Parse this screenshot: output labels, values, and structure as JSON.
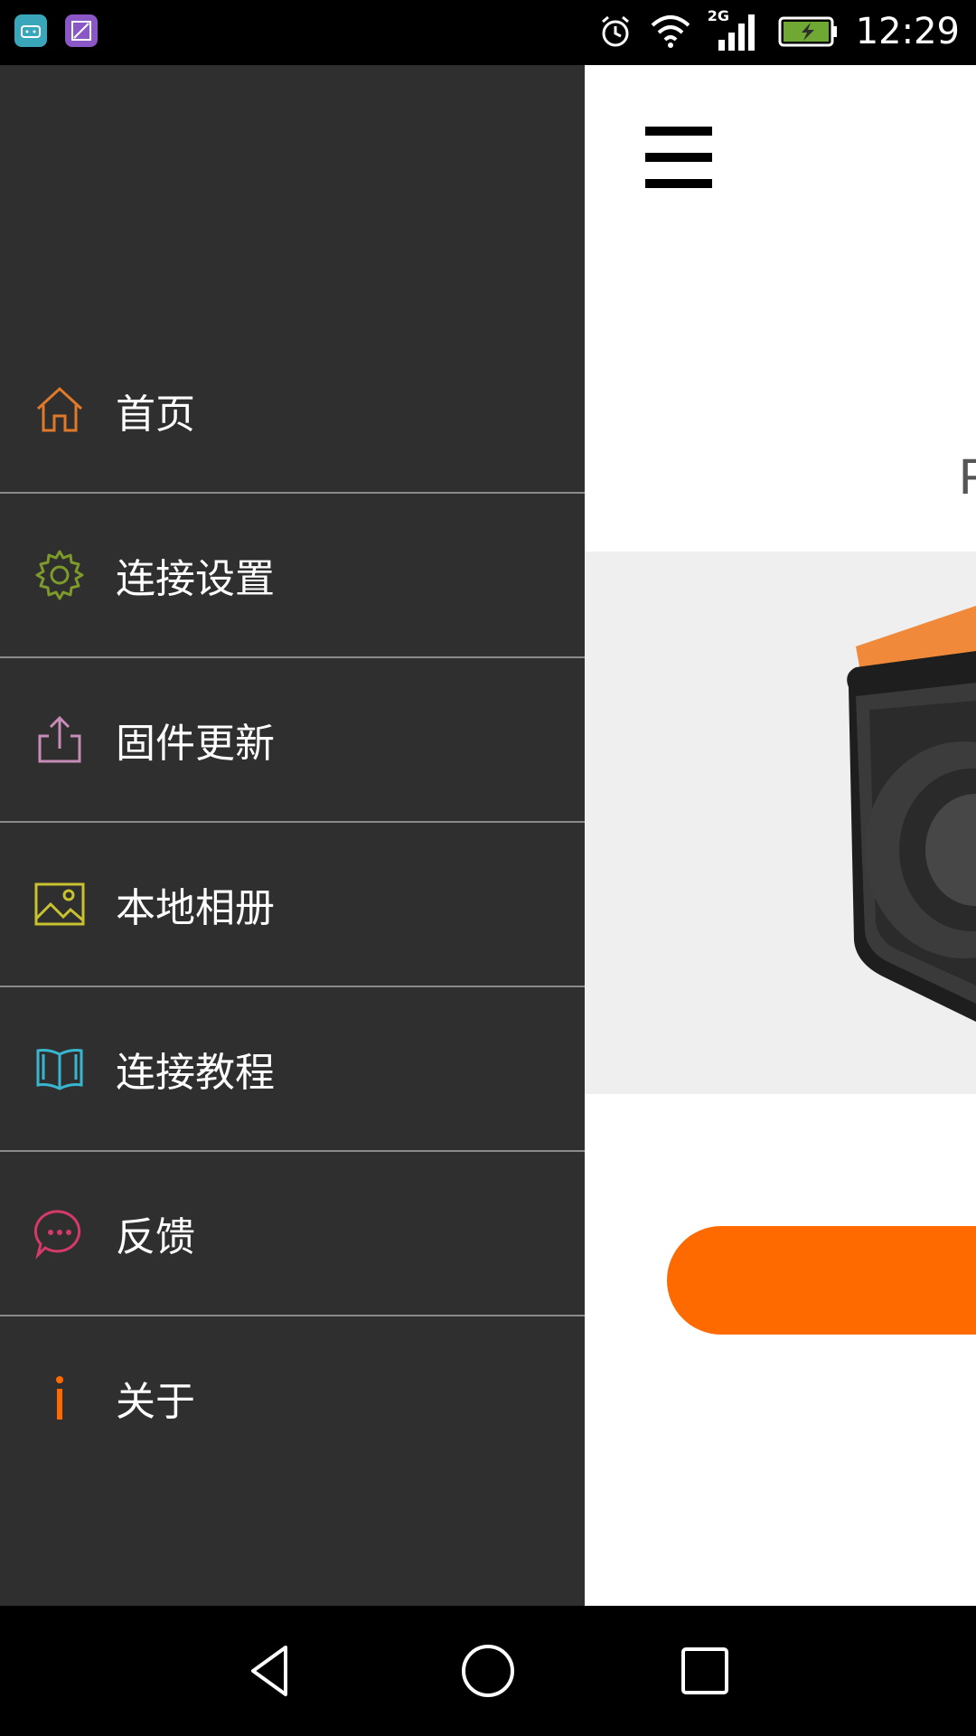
{
  "status_bar": {
    "time": "12:29",
    "network_type": "2G",
    "notification_icons": [
      "android-icon",
      "gallery-icon"
    ],
    "system_icons": [
      "alarm-icon",
      "wifi-icon",
      "signal-icon",
      "battery-charging-icon"
    ]
  },
  "drawer": {
    "items": [
      {
        "label": "首页",
        "icon": "home-icon",
        "icon_color": "#e07a2a"
      },
      {
        "label": "连接设置",
        "icon": "gear-icon",
        "icon_color": "#7d9a2a"
      },
      {
        "label": "固件更新",
        "icon": "upload-icon",
        "icon_color": "#c78bb8"
      },
      {
        "label": "本地相册",
        "icon": "image-icon",
        "icon_color": "#c9c22e"
      },
      {
        "label": "连接教程",
        "icon": "book-icon",
        "icon_color": "#39b6cf"
      },
      {
        "label": "反馈",
        "icon": "chat-icon",
        "icon_color": "#d63a6a"
      },
      {
        "label": "关于",
        "icon": "info-icon",
        "icon_color": "#ff6a00"
      }
    ]
  },
  "app": {
    "partial_text": "F",
    "accent_color": "#ff6a00"
  },
  "nav_bar": {
    "buttons": [
      "back-icon",
      "home-circle-icon",
      "recents-icon"
    ]
  }
}
